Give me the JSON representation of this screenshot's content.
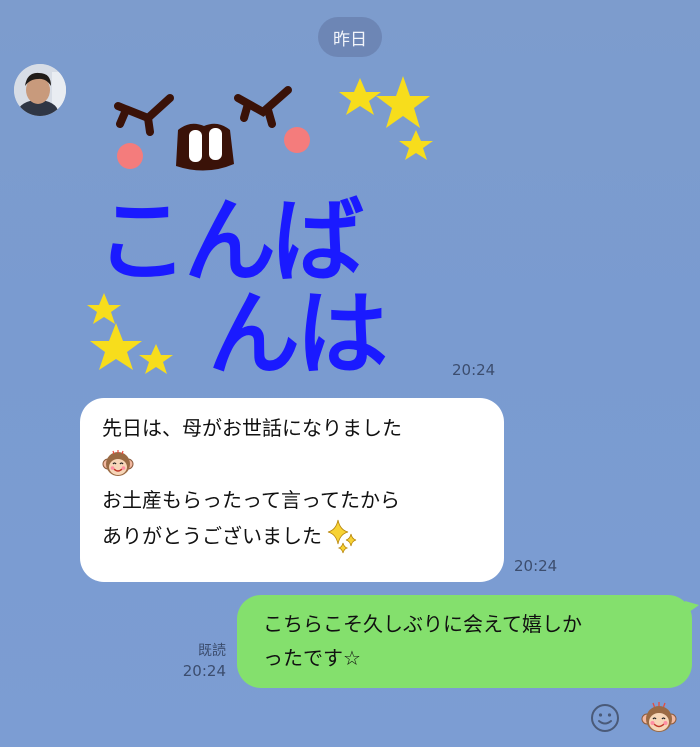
{
  "chat": {
    "date_label": "昨日",
    "incoming": {
      "sticker": {
        "text_line1": "こんば",
        "text_line2": "んは",
        "time": "20:24"
      },
      "message": {
        "lines": [
          "先日は、母がお世話になりました",
          "お土産もらったって言ってたから",
          "ありがとうございました"
        ],
        "time": "20:24"
      }
    },
    "outgoing": {
      "lines": [
        "こちらこそ久しぶりに会えて嬉しか",
        "ったです☆"
      ],
      "read_label": "既読",
      "time": "20:24"
    }
  },
  "colors": {
    "background": "#7c9dd0",
    "outgoing_bubble": "#84e06d",
    "incoming_bubble": "#ffffff",
    "sticker_text": "#1a1aff",
    "star": "#f7dd1c"
  },
  "icons": {
    "smile": "emoji-face-icon",
    "monkey": "monkey-sticker-icon",
    "sparkle": "sparkle-icon"
  }
}
